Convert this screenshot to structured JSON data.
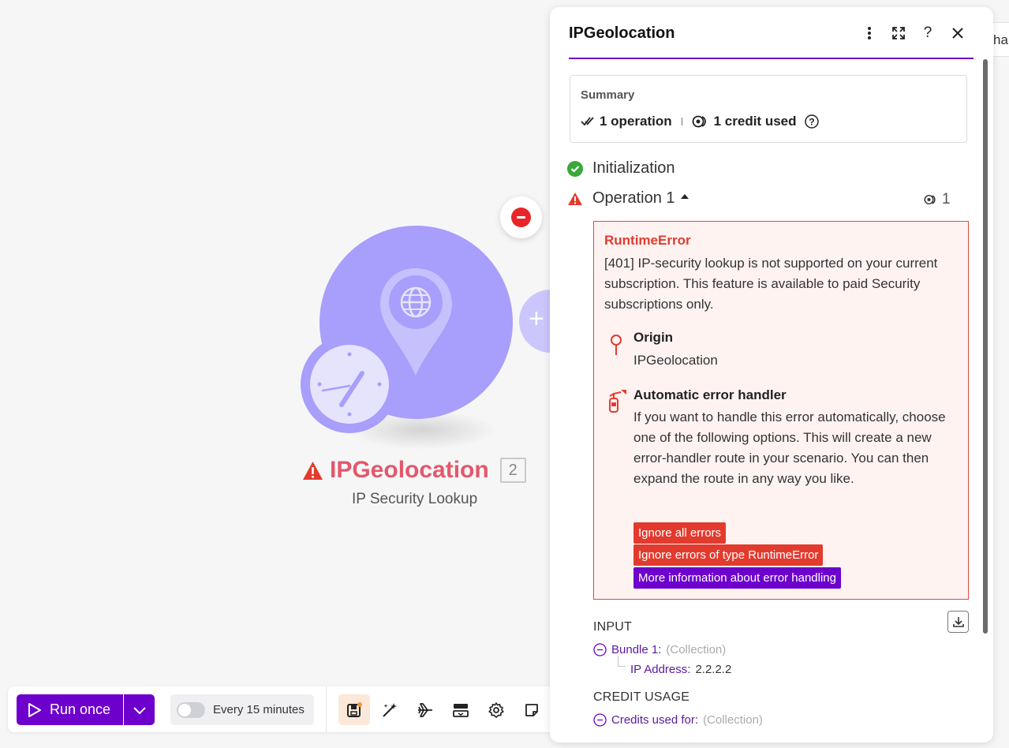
{
  "canvas": {
    "background_panel_peek": "ha",
    "module": {
      "title": "IPGeolocation",
      "id": "2",
      "subtitle": "IP Security Lookup",
      "warning_icon": "warning-triangle-icon",
      "accent_color": "#a79ffb",
      "title_color": "#e4576b"
    }
  },
  "toolbar": {
    "run_label": "Run once",
    "schedule_label": "Every 15 minutes",
    "icons": [
      "save-icon",
      "magic-wand-icon",
      "airplane-icon",
      "layout-icon",
      "gear-icon",
      "note-icon"
    ]
  },
  "panel": {
    "title": "IPGeolocation",
    "header_icons": [
      "kebab-menu-icon",
      "expand-icon",
      "help-icon",
      "close-icon"
    ],
    "summary": {
      "label": "Summary",
      "operations": "1 operation",
      "credits": "1 credit used"
    },
    "steps": {
      "initialization": "Initialization",
      "operation": "Operation 1",
      "operation_count": "1"
    },
    "error": {
      "type": "RuntimeError",
      "message": "[401] IP-security lookup is not supported on your current subscription. This feature is available to paid Security subscriptions only.",
      "origin_label": "Origin",
      "origin_value": "IPGeolocation",
      "handler_label": "Automatic error handler",
      "handler_text": "If you want to handle this error automatically, choose one of the following options. This will create a new error-handler route in your scenario. You can then expand the route in any way you like.",
      "buttons": {
        "ignore_all": "Ignore all errors",
        "ignore_type": "Ignore errors of type RuntimeError",
        "more_info": "More information about error handling"
      }
    },
    "input": {
      "label": "INPUT",
      "bundle_key": "Bundle 1:",
      "bundle_type": "(Collection)",
      "ip_key": "IP Address:",
      "ip_value": "2.2.2.2"
    },
    "credit_usage": {
      "label": "CREDIT USAGE",
      "key": "Credits used for:",
      "type": "(Collection)"
    },
    "colors": {
      "accent": "#6d00cc",
      "error": "#e23b2e",
      "success": "#3aa83a"
    }
  }
}
